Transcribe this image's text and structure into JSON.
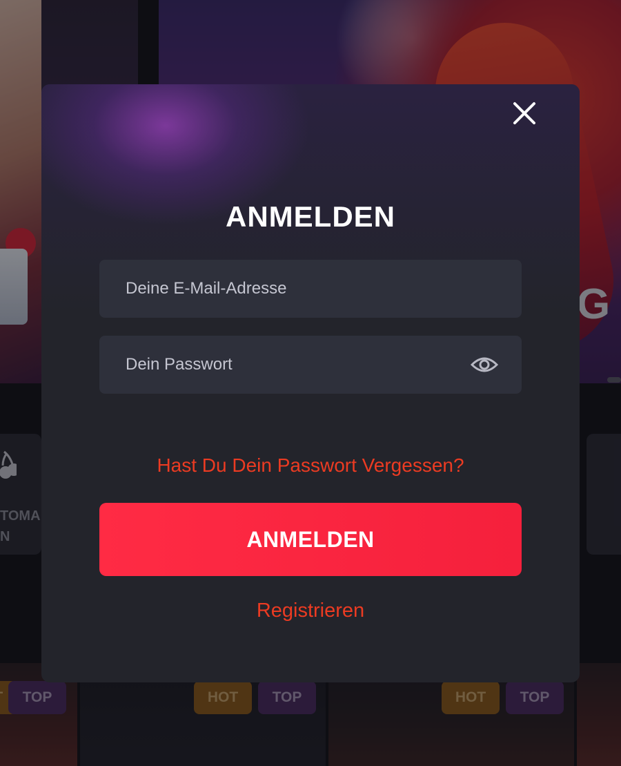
{
  "background": {
    "banner_partial_text": "G",
    "category_partial_label": "TOMA\nN",
    "badges": [
      "HOT",
      "TOP",
      "HOT",
      "TOP",
      "HOT",
      "TOP"
    ]
  },
  "modal": {
    "title": "ANMELDEN",
    "email_placeholder": "Deine E-Mail-Adresse",
    "password_placeholder": "Dein Passwort",
    "forgot_password_link": "Hast Du Dein Passwort Vergessen?",
    "login_button_label": "ANMELDEN",
    "register_link": "Registrieren",
    "close_icon": "close-icon",
    "eye_icon": "eye-icon"
  },
  "colors": {
    "accent_red": "#ff2b44",
    "link_orange": "#ec3b22",
    "modal_bg": "#23242b",
    "field_bg": "#2e303b"
  }
}
